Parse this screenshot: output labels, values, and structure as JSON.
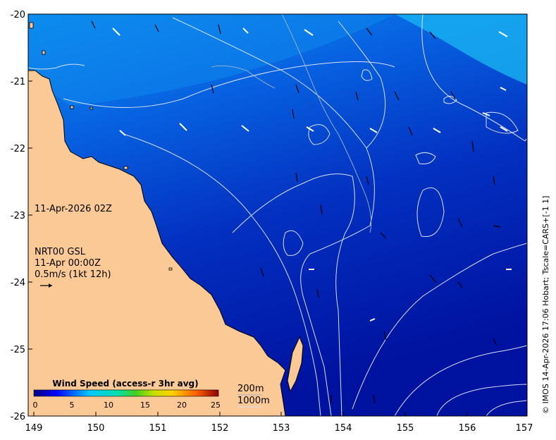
{
  "map": {
    "lon_ticks": [
      "149",
      "150",
      "151",
      "152",
      "153",
      "154",
      "155",
      "156",
      "157"
    ],
    "lat_ticks": [
      "-20",
      "-21",
      "-22",
      "-23",
      "-24",
      "-25",
      "-26"
    ],
    "lon_range": [
      149,
      157
    ],
    "lat_range": [
      -26,
      -20
    ],
    "land_color": "#fbc996",
    "water_shallow_color": "#0a8ff0",
    "water_deep_color": "#00129e",
    "contour_color": "#d8e0f0"
  },
  "annotations": {
    "date_label": "11-Apr-2026 02Z",
    "source_label": "NRT00 GSL",
    "source_time": "11-Apr 00:00Z",
    "scale_label": "0.5m/s (1kt 12h)"
  },
  "colorbar": {
    "title": "Wind Speed (access-r 3hr avg)",
    "ticks": [
      "0",
      "5",
      "10",
      "15",
      "20",
      "25"
    ],
    "range": [
      0,
      25
    ]
  },
  "legend": {
    "contour_200": "200m",
    "contour_1000": "1000m"
  },
  "credit": "© IMOS 14-Apr-2026 17:06 Hobart; Tscale=CARS+[-1 1]"
}
